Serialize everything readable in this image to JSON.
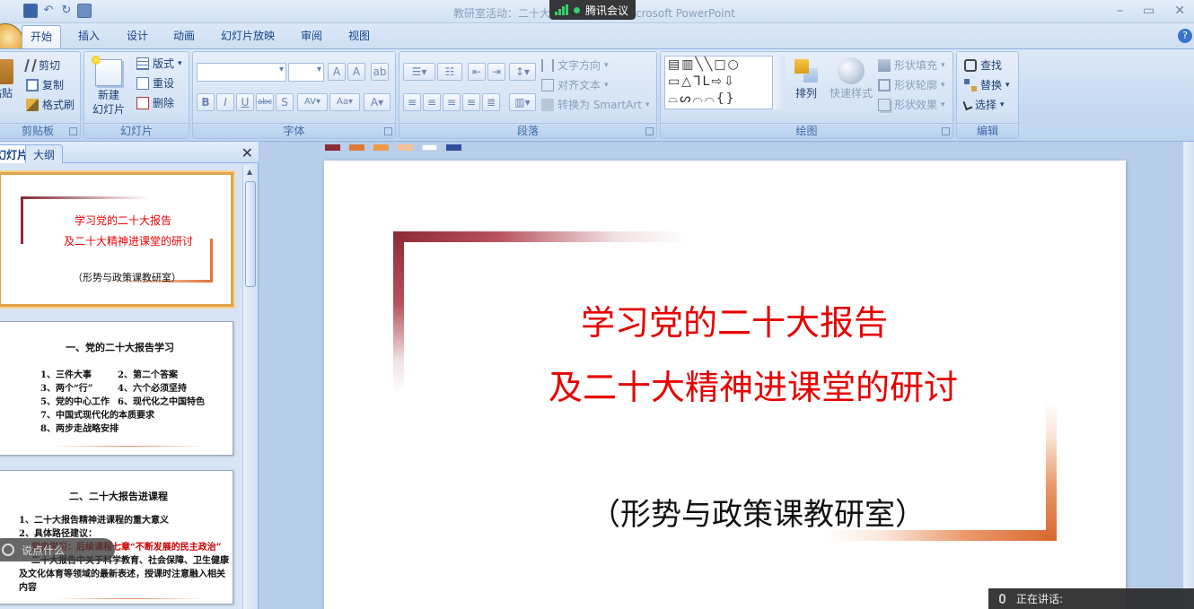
{
  "window": {
    "title": "教研室活动：二十大报告 - Microsoft PowerPoint",
    "title_left": "教研室活动：二十大",
    "title_right": "crosoft PowerPoint"
  },
  "meeting": {
    "badge_label": "腾讯会议",
    "chat_placeholder": "说点什么",
    "speaking_label": "正在讲话:"
  },
  "ribbon": {
    "tabs": [
      "开始",
      "插入",
      "设计",
      "动画",
      "幻灯片放映",
      "审阅",
      "视图"
    ],
    "clipboard": {
      "title": "剪贴板",
      "paste": "粘贴",
      "cut": "剪切",
      "copy": "复制",
      "format_painter": "格式刷"
    },
    "slides": {
      "title": "幻灯片",
      "new_slide_line1": "新建",
      "new_slide_line2": "幻灯片",
      "layout": "版式",
      "reset": "重设",
      "delete": "删除"
    },
    "font": {
      "title": "字体"
    },
    "paragraph": {
      "title": "段落",
      "text_direction": "文字方向",
      "align_text": "对齐文本",
      "convert_smartart": "转换为 SmartArt"
    },
    "drawing": {
      "title": "绘图",
      "arrange": "排列",
      "quick_styles": "快速样式",
      "shape_fill": "形状填充",
      "shape_outline": "形状轮廓",
      "shape_effects": "形状效果"
    },
    "editing": {
      "title": "编辑",
      "find": "查找",
      "replace": "替换",
      "select": "选择"
    }
  },
  "panel": {
    "tab_slides": "幻灯片",
    "tab_outline": "大纲",
    "thumbnails": [
      {
        "title1": "学习党的二十大报告",
        "title2": "及二十大精神进课堂的研讨",
        "subtitle": "（形势与政策课教研室）"
      },
      {
        "heading": "一、党的二十大报告学习",
        "items_left": [
          "1、三件大事",
          "3、两个“行”",
          "5、党的中心工作",
          "7、中国式现代化的本质要求",
          "8、两步走战略安排"
        ],
        "items_right": [
          "2、第二个答案",
          "4、六个必须坚持",
          "6、现代化之中国特色"
        ]
      },
      {
        "heading": "二、二十大报告进课程",
        "items": [
          "1、二十大报告精神进课程的重大意义",
          "2、具体路径建议：",
          "党史学习：后续课程七章“不断发展的民主政治”",
          "二十大报告中关于科学教育、社会保障、卫生健康",
          "及文化体育等领域的最新表述，授课时注意融入相关",
          "内容"
        ]
      }
    ]
  },
  "slide": {
    "title_line1": "学习党的二十大报告",
    "title_line2": "及二十大精神进课堂的研讨",
    "subtitle": "（形势与政策课教研室）"
  },
  "theme_swatches": [
    "#8c2a35",
    "#e07a3a",
    "#f09a4a",
    "#f5c09a",
    "#ffffff",
    "#2f4e9c"
  ]
}
